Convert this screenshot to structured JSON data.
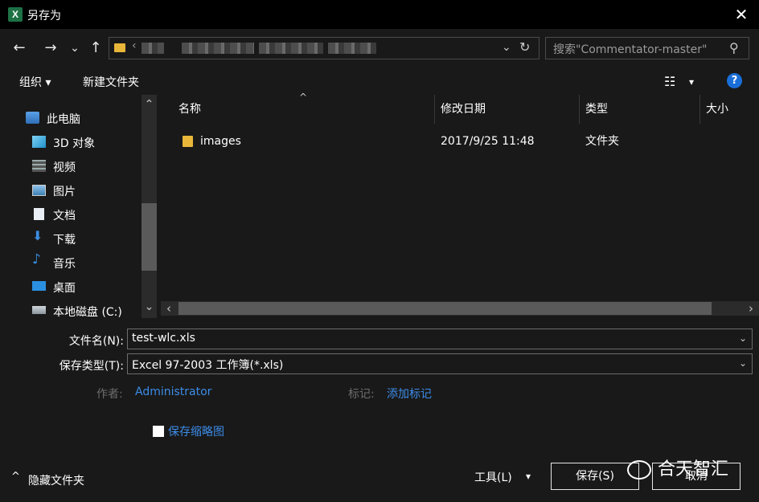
{
  "window": {
    "title": "另存为",
    "app_icon_letter": "X",
    "close_glyph": "✕"
  },
  "nav": {
    "back": "←",
    "forward": "→",
    "recent": "⌄",
    "up": "↑",
    "address_chevron": "⌄",
    "refresh": "↻",
    "address_lead": "‹",
    "search_placeholder": "搜索\"Commentator-master\"",
    "search_glyph": "⚲"
  },
  "toolbar": {
    "organize": "组织 ▾",
    "new_folder": "新建文件夹",
    "view_glyph": "☷",
    "view_dropdown": "▾",
    "help": "?"
  },
  "sidebar": {
    "items": [
      {
        "label": "此电脑",
        "icon": "computer-icon"
      },
      {
        "label": "3D 对象",
        "icon": "cube-icon"
      },
      {
        "label": "视频",
        "icon": "video-icon"
      },
      {
        "label": "图片",
        "icon": "picture-icon"
      },
      {
        "label": "文档",
        "icon": "document-icon"
      },
      {
        "label": "下载",
        "icon": "download-icon"
      },
      {
        "label": "音乐",
        "icon": "music-icon"
      },
      {
        "label": "桌面",
        "icon": "desktop-icon"
      },
      {
        "label": "本地磁盘 (C:)",
        "icon": "drive-icon"
      }
    ],
    "scroll_up": "⌃",
    "scroll_down": "⌄"
  },
  "file_list": {
    "sort_indicator": "^",
    "columns": [
      "名称",
      "修改日期",
      "类型",
      "大小"
    ],
    "rows": [
      {
        "name": "images",
        "modified": "2017/9/25 11:48",
        "type": "文件夹",
        "size": ""
      }
    ],
    "scroll_left": "‹",
    "scroll_right": "›"
  },
  "form": {
    "filename_label": "文件名(N):",
    "filename_value": "test-wlc.xls",
    "filetype_label": "保存类型(T):",
    "filetype_value": "Excel 97-2003 工作簿(*.xls)",
    "author_label": "作者:",
    "author_value": "Administrator",
    "tags_label": "标记:",
    "tags_value": "添加标记",
    "thumbnail_label": "保存缩略图",
    "dropdown_glyph": "⌄"
  },
  "footer": {
    "hide_folders": "隐藏文件夹",
    "hide_glyph": "^",
    "tools": "工具(L)",
    "tools_glyph": "▾",
    "save": "保存(S)",
    "cancel": "取消",
    "watermark": "合天智汇"
  },
  "colors": {
    "background": "#191919",
    "title_bar": "#000000",
    "accent_link": "#3c8ce7",
    "help_blue": "#1a6ed8",
    "excel_green": "#1e7145",
    "folder_yellow": "#e8b73a"
  }
}
